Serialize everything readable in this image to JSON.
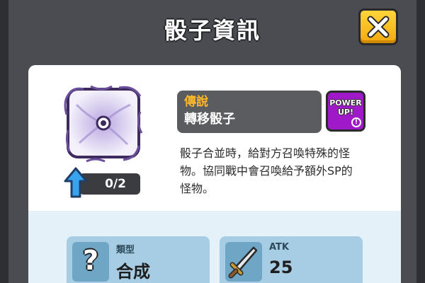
{
  "window": {
    "title": "骰子資訊"
  },
  "dice": {
    "rarity": "傳說",
    "name": "轉移骰子",
    "level_progress": "0/2",
    "description_lines": [
      "骰子合並時，給對方召喚特殊的怪",
      "物。協同戰中會召喚給予額外SP的",
      "怪物。"
    ]
  },
  "power_up": {
    "line1": "POWER",
    "line2": "UP!",
    "info": "!"
  },
  "stats": [
    {
      "label": "類型",
      "value": "合成",
      "icon": "question-mark-icon",
      "icon_glyph": "?"
    },
    {
      "label": "ATK",
      "value": "25",
      "icon": "sword-icon"
    }
  ],
  "icons": {
    "close": "close-icon",
    "dice": "dice-image",
    "upgrade": "up-arrow-icon"
  },
  "colors": {
    "background": "#4a4c51",
    "close_button": "#f2b51a",
    "rarity": "#ffb72b",
    "power_up": "#a019c9",
    "stat_card": "#a6cde3"
  }
}
